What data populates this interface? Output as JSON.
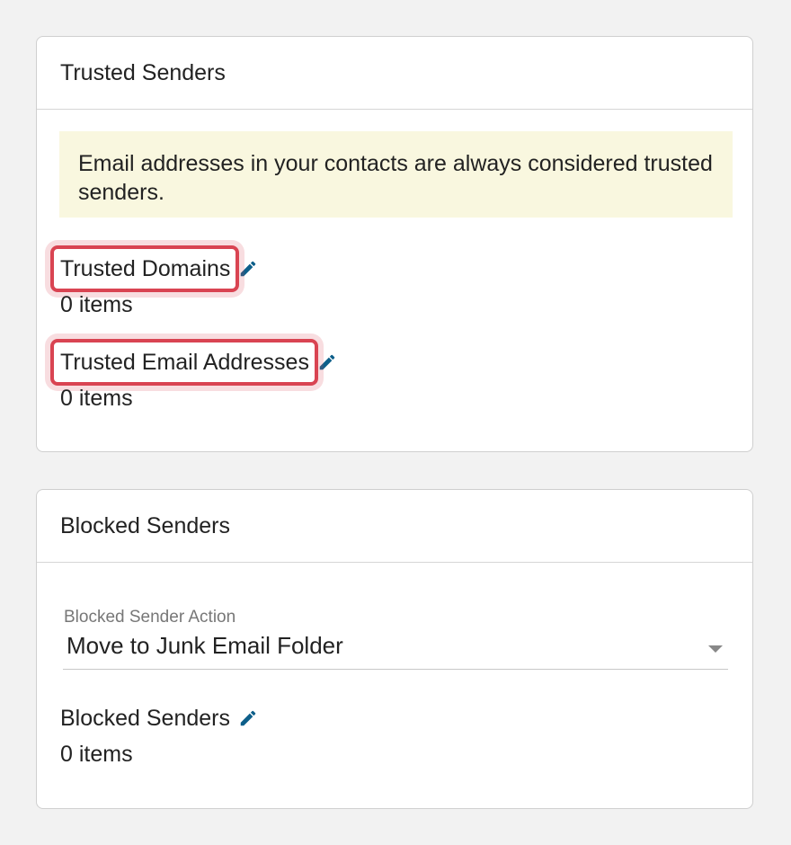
{
  "trusted": {
    "title": "Trusted Senders",
    "notice": "Email addresses in your contacts are always considered trusted senders.",
    "domains": {
      "label": "Trusted Domains",
      "count": "0 items"
    },
    "emails": {
      "label": "Trusted Email Addresses",
      "count": "0 items"
    }
  },
  "blocked": {
    "title": "Blocked Senders",
    "action_label": "Blocked Sender Action",
    "action_value": "Move to Junk Email Folder",
    "senders": {
      "label": "Blocked Senders",
      "count": "0 items"
    }
  },
  "icons": {
    "edit": "pencil-icon"
  },
  "colors": {
    "accent": "#0d5f8a",
    "highlight": "#d94452",
    "notice_bg": "#f9f7df"
  }
}
